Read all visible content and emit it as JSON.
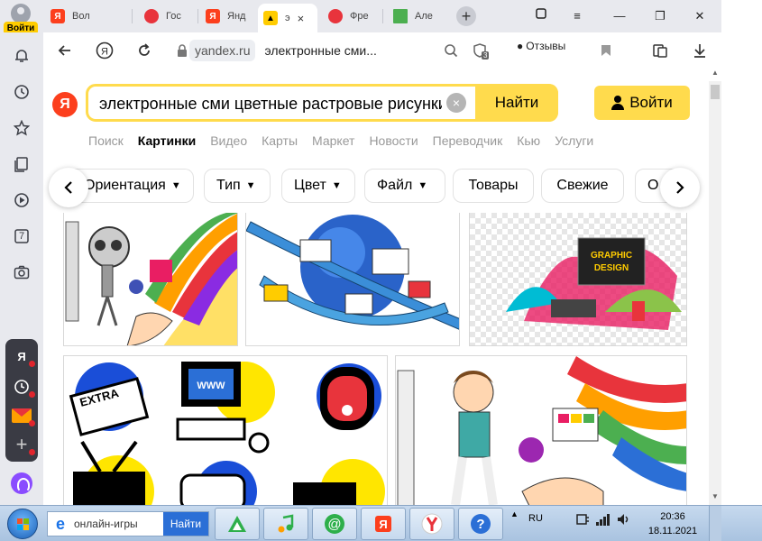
{
  "browser": {
    "login_badge": "Войти",
    "tabs": [
      {
        "label": "Вол",
        "favicon": "yandex-y",
        "color": "#fc3f1d"
      },
      {
        "label": "Гос",
        "favicon": "gosuslugi",
        "color": "#e8343c"
      },
      {
        "label": "Янд",
        "favicon": "yandex-y",
        "color": "#fc3f1d"
      },
      {
        "label": "э",
        "favicon": "yandex-images",
        "color": "#ffcc00"
      },
      {
        "label": "Фре",
        "favicon": "site-icon",
        "color": "#e8343c"
      },
      {
        "label": "Але",
        "favicon": "green-square",
        "color": "#4caf50"
      }
    ],
    "newtab_symbol": "+",
    "sidebar_ext_label": "Я",
    "sidebar_ext_counter": "7",
    "omnibox": {
      "domain": "yandex.ru",
      "title": "электронные сми...",
      "reviews_label": "Отзывы",
      "ext_badge": "3"
    }
  },
  "page": {
    "logo_letter": "Я",
    "search": {
      "query": "электронные сми цветные растровые рисунки",
      "clear_symbol": "×",
      "submit_label": "Найти"
    },
    "login_label": "Войти",
    "services": [
      {
        "label": "Поиск",
        "active": false
      },
      {
        "label": "Картинки",
        "active": true
      },
      {
        "label": "Видео",
        "active": false
      },
      {
        "label": "Карты",
        "active": false
      },
      {
        "label": "Маркет",
        "active": false
      },
      {
        "label": "Новости",
        "active": false
      },
      {
        "label": "Переводчик",
        "active": false
      },
      {
        "label": "Кью",
        "active": false
      },
      {
        "label": "Услуги",
        "active": false
      }
    ],
    "filters": [
      {
        "label": "Ориентация",
        "dropdown": true
      },
      {
        "label": "Тип",
        "dropdown": true
      },
      {
        "label": "Цвет",
        "dropdown": true
      },
      {
        "label": "Файл",
        "dropdown": true
      },
      {
        "label": "Товары",
        "dropdown": false
      },
      {
        "label": "Свежие",
        "dropdown": false
      },
      {
        "label": "О",
        "dropdown": false
      }
    ],
    "image_labels": {
      "graphic_design": [
        "GRAPHIC",
        "DESIGN"
      ],
      "extra": "EXTRA",
      "www": "WWW"
    }
  },
  "taskbar": {
    "search_query": "онлайн-игры",
    "search_button": "Найти",
    "lang": "RU",
    "time": "20:36",
    "date": "18.11.2021"
  },
  "colors": {
    "yandex_yellow": "#ffdb4d",
    "yandex_red": "#fc3f1d",
    "chrome_gray": "#e8e9ee",
    "taskbar_blue": "#c6d9ee"
  }
}
